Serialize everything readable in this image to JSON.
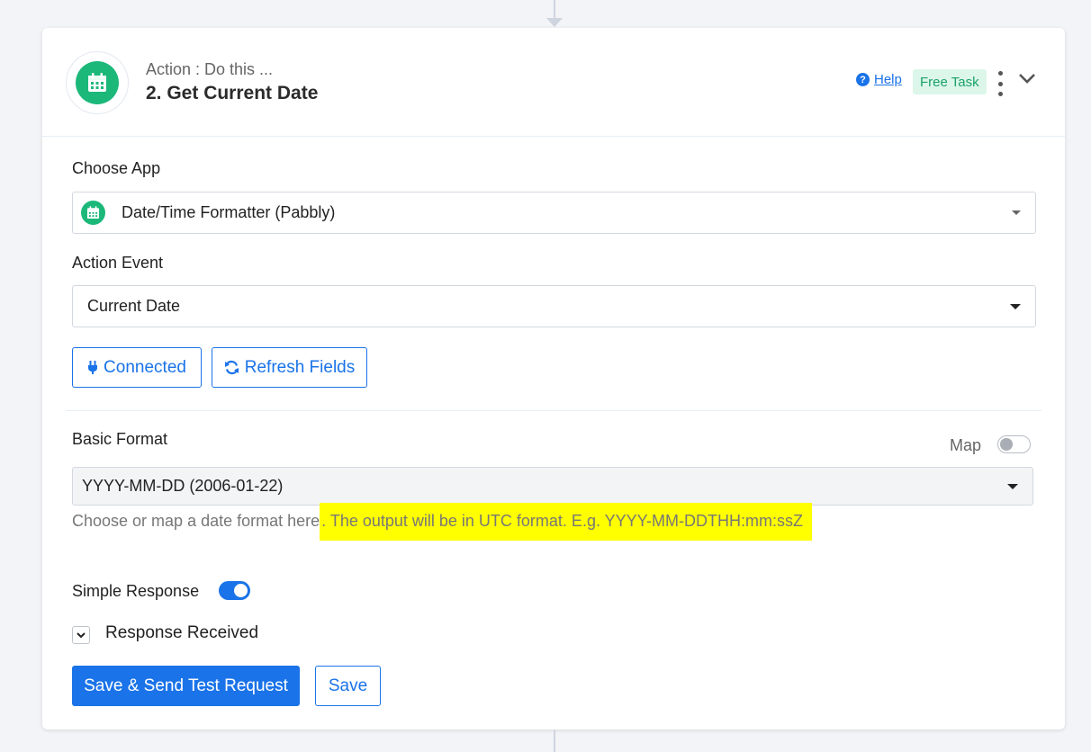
{
  "step": {
    "subtitle": "Action : Do this ...",
    "title": "2. Get Current Date",
    "icon": "calendar-icon"
  },
  "header_actions": {
    "help_label": "Help",
    "help_icon_glyph": "?",
    "badge": "Free Task"
  },
  "choose_app": {
    "label": "Choose App",
    "value": "Date/Time Formatter (Pabbly)",
    "icon": "calendar-icon"
  },
  "action_event": {
    "label": "Action Event",
    "value": "Current Date"
  },
  "buttons": {
    "connected": "Connected",
    "refresh": "Refresh Fields",
    "save_send": "Save & Send Test Request",
    "save": "Save"
  },
  "basic_format": {
    "label": "Basic Format",
    "map_label": "Map",
    "map_enabled": false,
    "value": "YYYY-MM-DD (2006-01-22)",
    "hint_plain": "Choose or map a date format here",
    "hint_highlighted": ". The output will be in UTC format. E.g. YYYY-MM-DDTHH:mm:ssZ",
    "highlight_color": "#ffff00"
  },
  "simple_response": {
    "label": "Simple Response",
    "enabled": true
  },
  "response_received": {
    "label": "Response Received"
  },
  "colors": {
    "accent": "#1a73e8",
    "app_green": "#1cb87a",
    "badge_bg": "#dcf6ea",
    "badge_text": "#1aa266"
  }
}
